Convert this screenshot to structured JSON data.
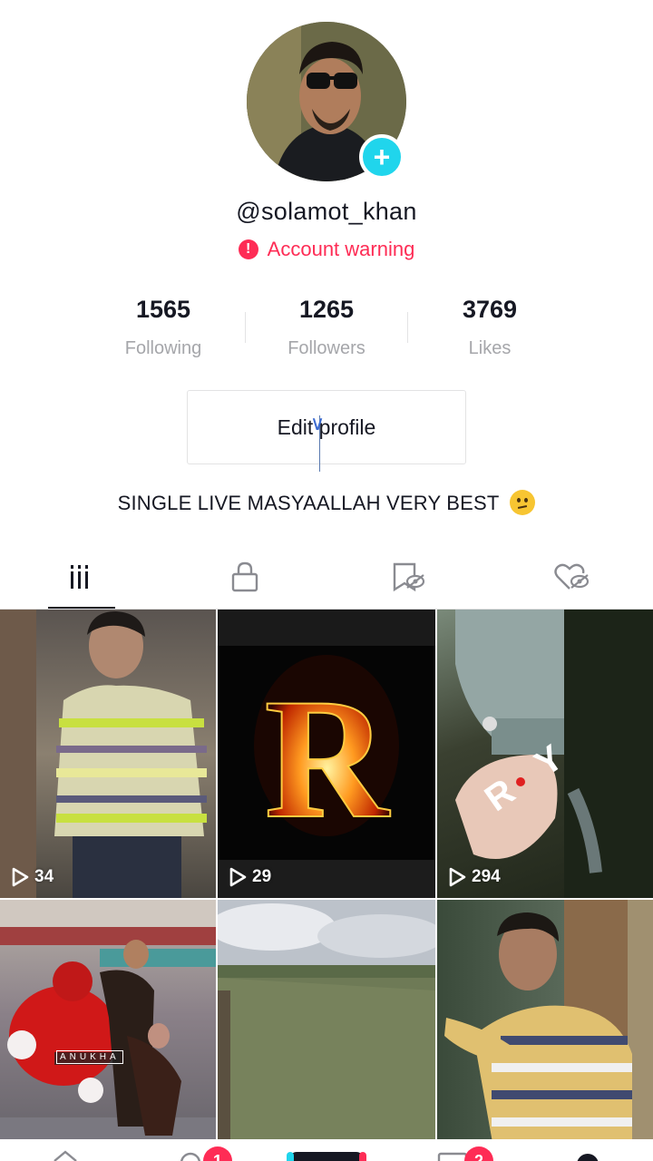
{
  "profile": {
    "username": "@solamot_khan",
    "warning": "Account warning",
    "bio": "SINGLE LIVE MASYAALLAH VERY BEST"
  },
  "stats": [
    {
      "value": "1565",
      "label": "Following"
    },
    {
      "value": "1265",
      "label": "Followers"
    },
    {
      "value": "3769",
      "label": "Likes"
    }
  ],
  "edit_button": "Edit profile",
  "tabs": [
    {
      "icon": "grid-icon",
      "active": true
    },
    {
      "icon": "lock-icon",
      "active": false
    },
    {
      "icon": "bookmark-hidden-icon",
      "active": false
    },
    {
      "icon": "heart-hidden-icon",
      "active": false
    }
  ],
  "videos": [
    {
      "views": "34"
    },
    {
      "views": "29"
    },
    {
      "views": "294"
    },
    {
      "views": ""
    },
    {
      "views": ""
    },
    {
      "views": ""
    }
  ],
  "overlay_text": {
    "ry": "R Y",
    "anukha": "ANUKHA",
    "fire_letter": "R"
  },
  "nav_badges": {
    "inbox": "1",
    "messages": "2"
  },
  "colors": {
    "accent": "#fe2c55",
    "add": "#20d5ec"
  }
}
